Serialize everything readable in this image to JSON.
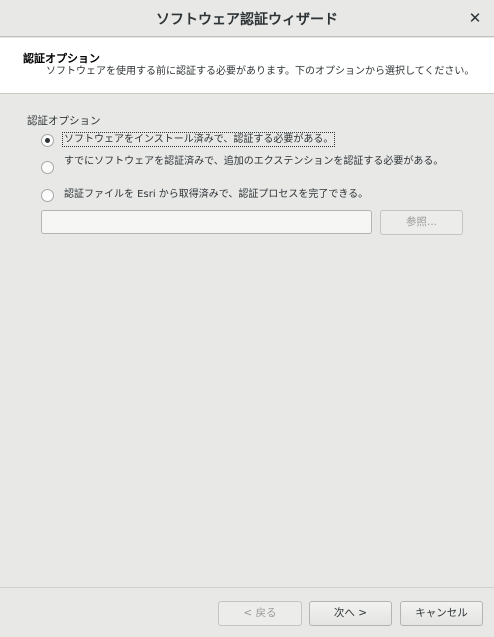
{
  "window": {
    "title": "ソフトウェア認証ウィザード",
    "close_glyph": "✕"
  },
  "header": {
    "title": "認証オプション",
    "description": "ソフトウェアを使用する前に認証する必要があります。下のオプションから選択してください。"
  },
  "options": {
    "group_label": "認証オプション",
    "items": [
      {
        "label": "ソフトウェアをインストール済みで、認証する必要がある。",
        "selected": true
      },
      {
        "label": "すでにソフトウェアを認証済みで、追加のエクステンションを認証する必要がある。",
        "selected": false
      },
      {
        "label": "認証ファイルを Esri から取得済みで、認証プロセスを完了できる。",
        "selected": false
      }
    ]
  },
  "file_path": {
    "value": "",
    "placeholder": ""
  },
  "buttons": {
    "browse": "参照...",
    "back": "< 戻る",
    "next": "次へ >",
    "cancel": "キャンセル"
  }
}
